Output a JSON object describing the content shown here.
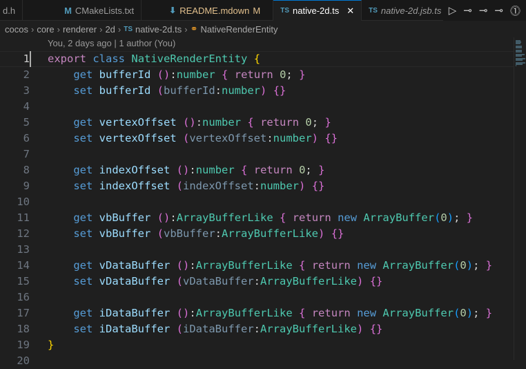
{
  "tabs": [
    {
      "label": "d.h",
      "icon": "",
      "state": ""
    },
    {
      "label": "CMakeLists.txt",
      "icon": "M",
      "state": ""
    },
    {
      "label": "README.mdown",
      "icon": "⬇",
      "badge": "M",
      "state": "modified"
    },
    {
      "label": "native-2d.ts",
      "icon": "TS",
      "state": "active"
    },
    {
      "label": "native-2d.jsb.ts",
      "icon": "TS",
      "state": "preview"
    }
  ],
  "actions": [
    {
      "icon": "run-icon",
      "glyph": "▷"
    },
    {
      "icon": "git-commit-icon",
      "glyph": "-o-"
    },
    {
      "icon": "git-commit-icon",
      "glyph": "-o-"
    },
    {
      "icon": "git-commit-icon",
      "glyph": "o-"
    },
    {
      "icon": "git-compare-icon",
      "glyph": "⓵"
    }
  ],
  "breadcrumb": [
    "cocos",
    "core",
    "renderer",
    "2d",
    "native-2d.ts",
    "NativeRenderEntity"
  ],
  "breadcrumb_ts_icon": "TS",
  "codelens": "You, 2 days ago | 1 author (You)",
  "code": {
    "lines": [
      "export class NativeRenderEntity {",
      "    get bufferId ():number { return 0; }",
      "    set bufferId (bufferId:number) {}",
      "",
      "    get vertexOffset ():number { return 0; }",
      "    set vertexOffset (vertexOffset:number) {}",
      "",
      "    get indexOffset ():number { return 0; }",
      "    set indexOffset (indexOffset:number) {}",
      "",
      "    get vbBuffer ():ArrayBufferLike { return new ArrayBuffer(0); }",
      "    set vbBuffer (vbBuffer:ArrayBufferLike) {}",
      "",
      "    get vDataBuffer ():ArrayBufferLike { return new ArrayBuffer(0); }",
      "    set vDataBuffer (vDataBuffer:ArrayBufferLike) {}",
      "",
      "    get iDataBuffer ():ArrayBufferLike { return new ArrayBuffer(0); }",
      "    set iDataBuffer (iDataBuffer:ArrayBufferLike) {}",
      "}",
      ""
    ],
    "current_line": 1
  },
  "colors": {
    "keyword": "#569cd6",
    "control": "#c586c0",
    "type": "#4ec9b0",
    "property": "#9cdcfe",
    "number": "#b5cea8",
    "accent": "#0078d4"
  }
}
